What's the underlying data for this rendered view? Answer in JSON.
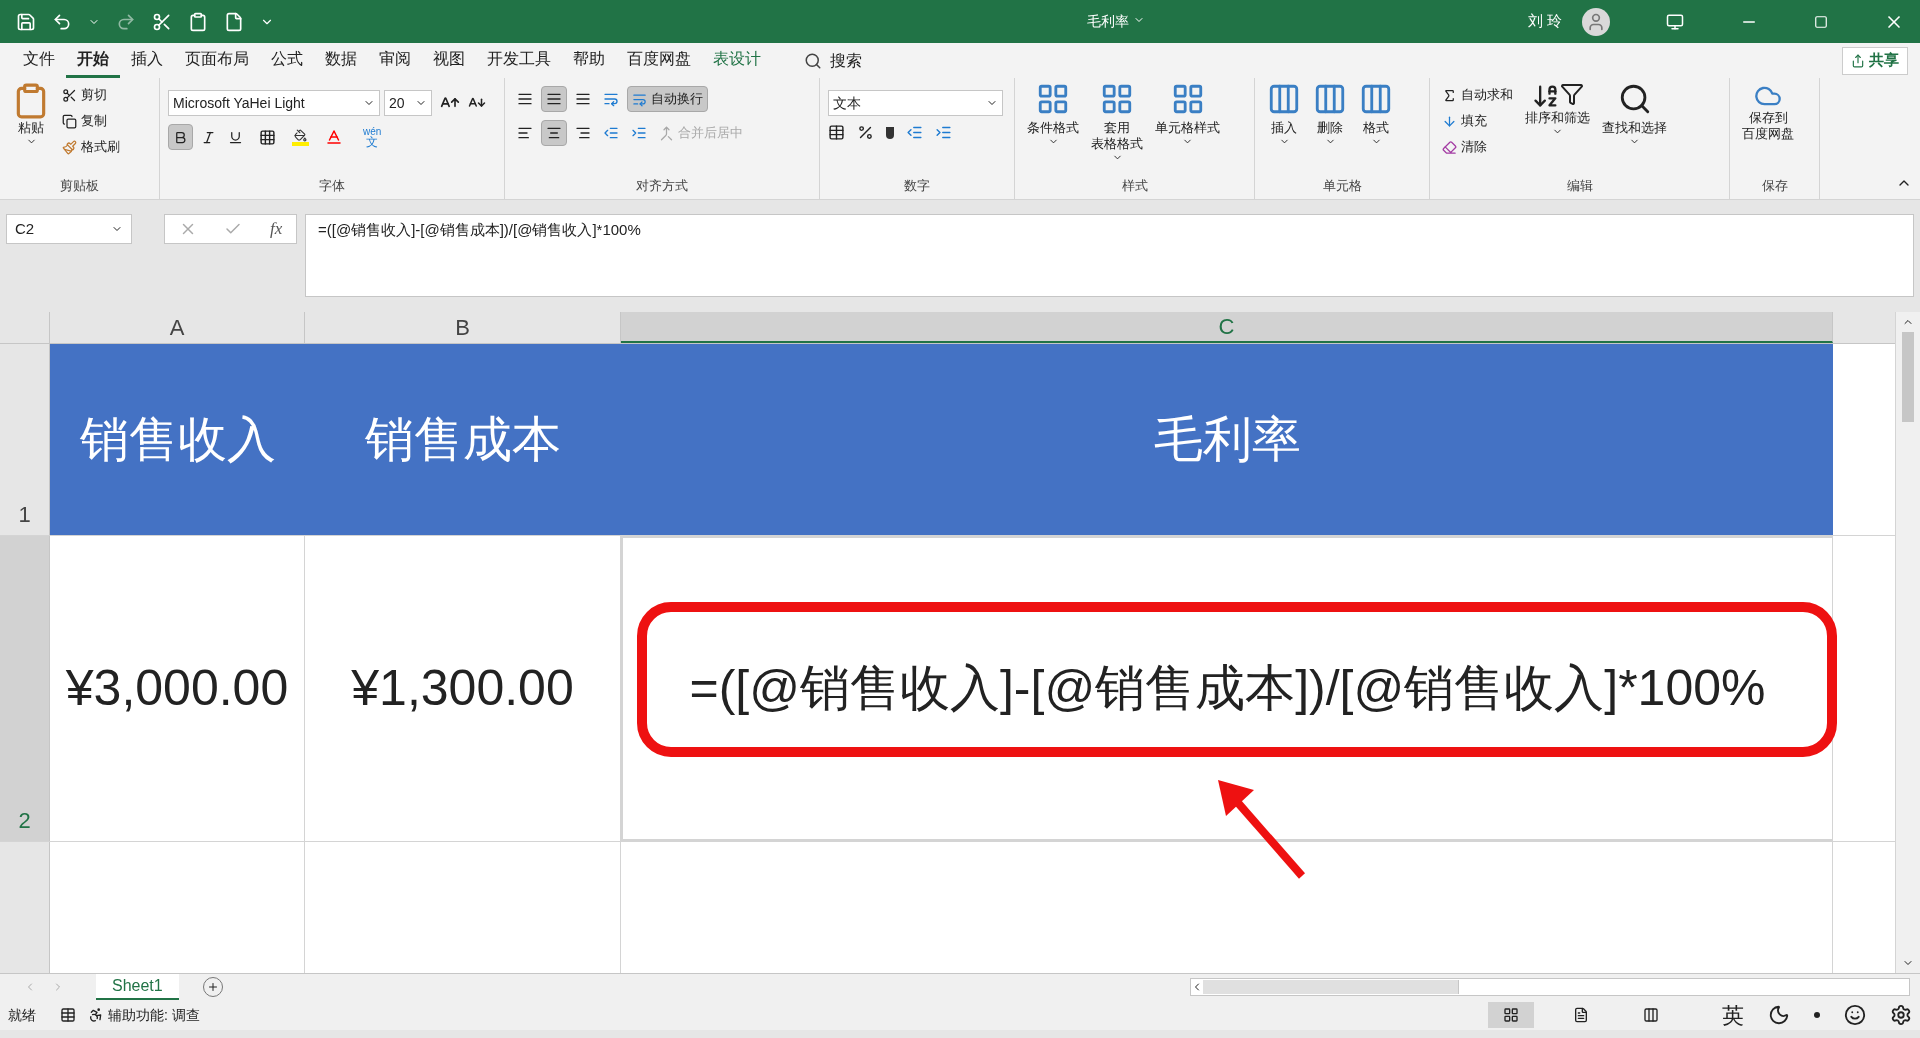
{
  "title_bar": {
    "title": "毛利率",
    "user": "刘 玲"
  },
  "menu_tabs": [
    {
      "label": "文件",
      "selected": false,
      "kind": "normal"
    },
    {
      "label": "开始",
      "selected": true,
      "kind": "normal"
    },
    {
      "label": "插入",
      "selected": false,
      "kind": "normal"
    },
    {
      "label": "页面布局",
      "selected": false,
      "kind": "normal"
    },
    {
      "label": "公式",
      "selected": false,
      "kind": "normal"
    },
    {
      "label": "数据",
      "selected": false,
      "kind": "normal"
    },
    {
      "label": "审阅",
      "selected": false,
      "kind": "normal"
    },
    {
      "label": "视图",
      "selected": false,
      "kind": "normal"
    },
    {
      "label": "开发工具",
      "selected": false,
      "kind": "normal"
    },
    {
      "label": "帮助",
      "selected": false,
      "kind": "normal"
    },
    {
      "label": "百度网盘",
      "selected": false,
      "kind": "normal"
    },
    {
      "label": "表设计",
      "selected": false,
      "kind": "contextual"
    }
  ],
  "search": "搜索",
  "share": "共享",
  "ribbon": {
    "clipboard": {
      "label": "剪贴板",
      "paste": "粘贴",
      "cut": "剪切",
      "copy": "复制",
      "format_painter": "格式刷"
    },
    "font": {
      "label": "字体",
      "font_name": "Microsoft YaHei Light",
      "font_size": "20",
      "bold": true,
      "phonetic_top": "wén",
      "phonetic_bottom": "文"
    },
    "alignment": {
      "label": "对齐方式",
      "vertical_middle": true,
      "center": true,
      "wrap_text": {
        "label": "自动换行",
        "on": true
      },
      "merge_center": {
        "label": "合并后居中",
        "disabled": true
      }
    },
    "number": {
      "label": "数字",
      "format": "文本"
    },
    "styles": {
      "label": "样式",
      "buttons": [
        [
          "条件格式"
        ],
        [
          "套用",
          "表格格式"
        ],
        [
          "单元格样式"
        ]
      ]
    },
    "cells": {
      "label": "单元格",
      "buttons": [
        "插入",
        "删除",
        "格式"
      ]
    },
    "editing": {
      "label": "编辑",
      "autosum": "自动求和",
      "fill": "填充",
      "clear": "清除",
      "sort_filter": "排序和筛选",
      "find_select": "查找和选择"
    },
    "save": {
      "label": "保存",
      "button": [
        "保存到",
        "百度网盘"
      ]
    }
  },
  "formula_bar": {
    "name_box": "C2",
    "insert_function": "fx",
    "formula": "=([@销售收入]-[@销售成本])/[@销售收入]*100%"
  },
  "grid": {
    "columns": [
      {
        "label": "A",
        "selected": false
      },
      {
        "label": "B",
        "selected": false
      },
      {
        "label": "C",
        "selected": true
      }
    ],
    "rows": [
      {
        "label": "1",
        "selected": false,
        "kind": "header",
        "cells": [
          "销售收入",
          "销售成本",
          "毛利率"
        ]
      },
      {
        "label": "2",
        "selected": true,
        "kind": "data",
        "cells": [
          "¥3,000.00",
          "¥1,300.00",
          "=([@销售收入]-[@销售成本])/[@销售收入]*100%"
        ]
      }
    ]
  },
  "sheet_tabs": [
    {
      "label": "Sheet1",
      "selected": true
    }
  ],
  "status_bar": {
    "ready": "就绪",
    "accessibility": "辅助功能: 调查",
    "view_modes": [
      {
        "selected": true
      },
      {
        "selected": false
      },
      {
        "selected": false
      }
    ]
  },
  "ime": {
    "language": "英"
  }
}
